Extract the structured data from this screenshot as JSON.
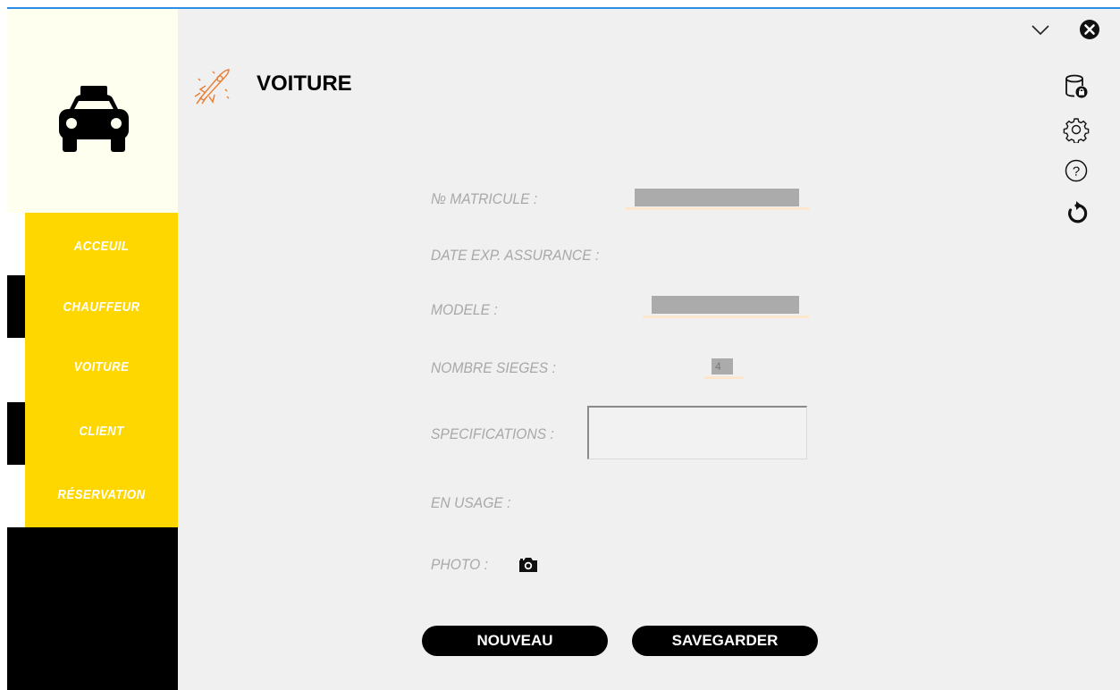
{
  "window": {
    "title": ""
  },
  "sidebar": {
    "logo": "taxi-icon",
    "items": [
      {
        "label": "ACCEUIL"
      },
      {
        "label": "CHAUFFEUR"
      },
      {
        "label": "VOITURE"
      },
      {
        "label": "CLIENT"
      },
      {
        "label": "RÉSERVATION"
      }
    ]
  },
  "header": {
    "title": "VOITURE",
    "icon": "rocket-icon"
  },
  "toolbar": {
    "icons": [
      "database-lock-icon",
      "gear-icon",
      "help-icon",
      "refresh-icon"
    ]
  },
  "form": {
    "matricule_label": "№ MATRICULE :",
    "matricule_value": "",
    "date_label": "DATE EXP. ASSURANCE :",
    "modele_label": "MODELE :",
    "modele_value": "",
    "sieges_label": "NOMBRE SIEGES :",
    "sieges_value": "4",
    "spec_label": "SPECIFICATIONS :",
    "spec_value": "",
    "usage_label": "EN USAGE :",
    "photo_label": "PHOTO :"
  },
  "buttons": {
    "nouveau": "NOUVEAU",
    "savegarder": "SAVEGARDER"
  },
  "colors": {
    "accent": "#ffd700",
    "background": "#f0f0f0",
    "sidebar": "#000000",
    "title_bar": "#2d8ce6"
  }
}
